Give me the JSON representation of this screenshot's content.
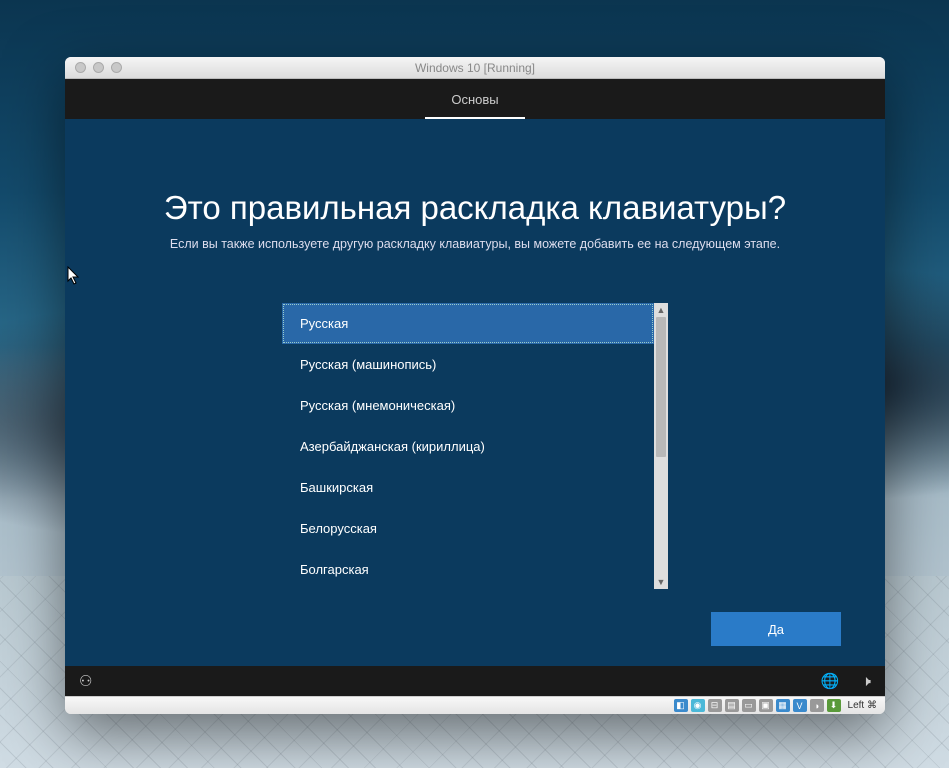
{
  "vm": {
    "title": "Windows 10 [Running]",
    "host_key": "Left ⌘"
  },
  "oobe": {
    "tab": "Основы",
    "heading": "Это правильная раскладка клавиатуры?",
    "subtitle": "Если вы также используете другую раскладку клавиатуры, вы можете добавить ее на следующем этапе.",
    "layouts": [
      "Русская",
      "Русская (машинопись)",
      "Русская (мнемоническая)",
      "Азербайджанская (кириллица)",
      "Башкирская",
      "Белорусская",
      "Болгарская"
    ],
    "yes_button": "Да"
  }
}
